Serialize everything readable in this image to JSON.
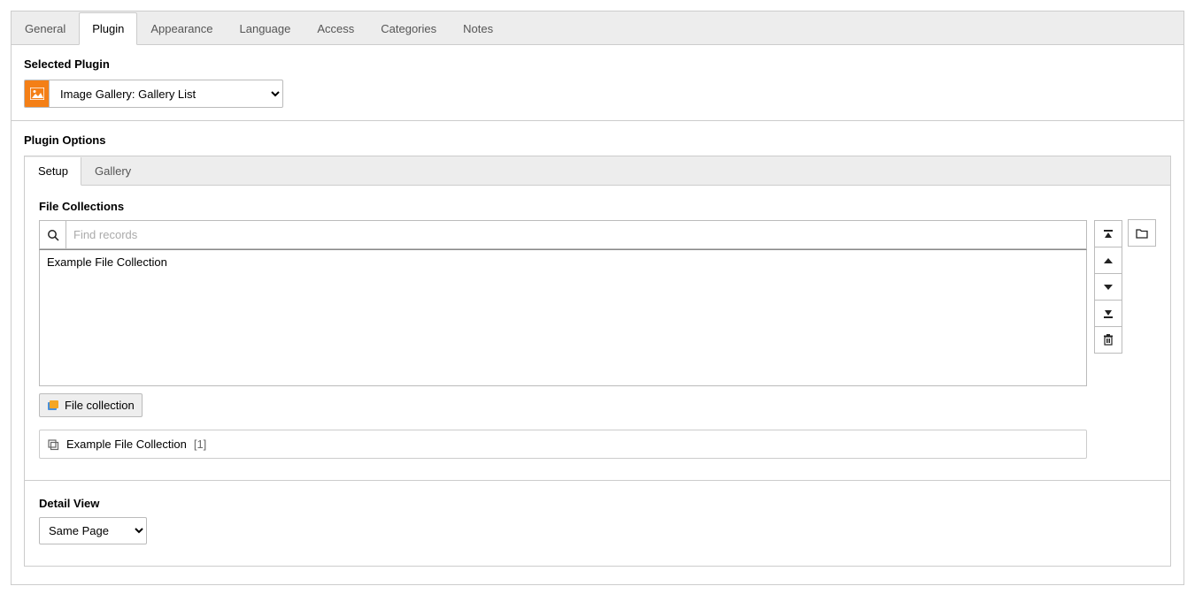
{
  "tabs": {
    "general": "General",
    "plugin": "Plugin",
    "appearance": "Appearance",
    "language": "Language",
    "access": "Access",
    "categories": "Categories",
    "notes": "Notes"
  },
  "selected_plugin": {
    "label": "Selected Plugin",
    "value": "Image Gallery: Gallery List"
  },
  "plugin_options": {
    "label": "Plugin Options",
    "tabs": {
      "setup": "Setup",
      "gallery": "Gallery"
    }
  },
  "file_collections": {
    "label": "File Collections",
    "search_placeholder": "Find records",
    "items": [
      "Example File Collection"
    ],
    "add_button": "File collection",
    "row": {
      "name": "Example File Collection",
      "count": "[1]"
    }
  },
  "detail_view": {
    "label": "Detail View",
    "value": "Same Page"
  }
}
